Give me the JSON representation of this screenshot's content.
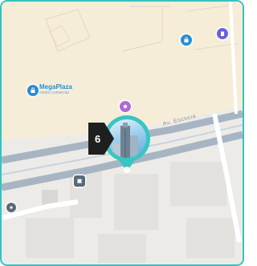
{
  "map": {
    "place": {
      "name": "MegaPlaza",
      "subtitle": "centro comercial"
    },
    "street": {
      "name": "Av. Escocia"
    }
  },
  "marker": {
    "count": "6",
    "accent": "#39c6c2",
    "badge_color": "#1f1f1f"
  },
  "pois": [
    {
      "icon": "shopping-bag-icon",
      "color": "#2a8dd0"
    },
    {
      "icon": "building-icon",
      "color": "#6a63d6"
    },
    {
      "icon": "shopping-bag-icon",
      "color": "#2a8dd0"
    },
    {
      "icon": "shop-icon",
      "color": "#b06ad8"
    },
    {
      "icon": "transit-icon",
      "color": "#5a6a7a"
    },
    {
      "icon": "location-dot-icon",
      "color": "#5a6a7a"
    }
  ],
  "colors": {
    "border": "#34c3c0",
    "land": "#f5ecd9",
    "road": "#a9b8c6"
  }
}
